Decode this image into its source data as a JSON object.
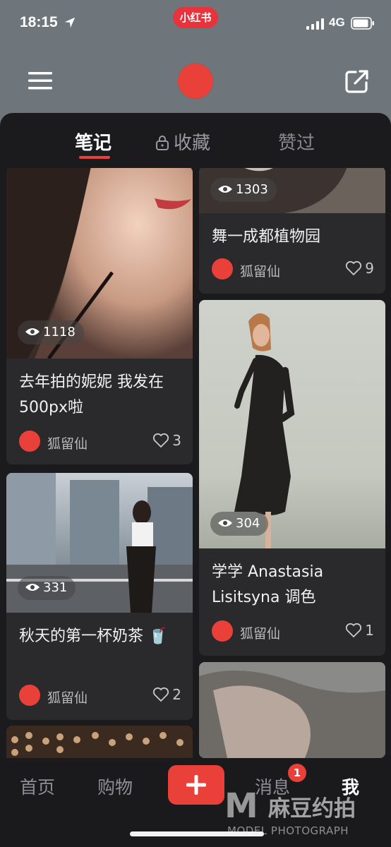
{
  "status_bar": {
    "time": "18:15",
    "network": "4G",
    "app_badge": "小红书",
    "icons": [
      "location-arrow-icon",
      "signal-icon",
      "battery-icon"
    ]
  },
  "header": {
    "icons": [
      "menu-icon",
      "avatar",
      "share-icon"
    ]
  },
  "tabs": [
    {
      "label": "笔记",
      "active": true
    },
    {
      "label": "收藏",
      "icon": "lock-icon"
    },
    {
      "label": "赞过"
    }
  ],
  "notes": [
    {
      "id": "left-1",
      "views": "1118",
      "title": "去年拍的妮妮 我发在 500px啦",
      "author": "狐留仙",
      "likes": "3"
    },
    {
      "id": "left-2",
      "views": "331",
      "title": "秋天的第一杯奶茶 🥤",
      "author": "狐留仙",
      "likes": "2"
    },
    {
      "id": "right-1",
      "views": "1303",
      "title": "舞一成都植物园",
      "author": "狐留仙",
      "likes": "9"
    },
    {
      "id": "right-2",
      "views": "304",
      "title": "学学 Anastasia Lisitsyna 调色",
      "author": "狐留仙",
      "likes": "1"
    }
  ],
  "bottom_nav": {
    "items": [
      {
        "label": "首页"
      },
      {
        "label": "购物"
      },
      {
        "label": "+",
        "icon": "plus-icon"
      },
      {
        "label": "消息",
        "badge": "1"
      },
      {
        "label": "我",
        "active": true
      }
    ]
  },
  "watermark": {
    "logo": "M",
    "text": "麻豆约拍",
    "sub": "MODEL PHOTOGRAPH"
  },
  "colors": {
    "accent": "#e9403a",
    "background": "#1b1b1e",
    "card": "#2a2a2d",
    "top_area": "#6f767b"
  }
}
